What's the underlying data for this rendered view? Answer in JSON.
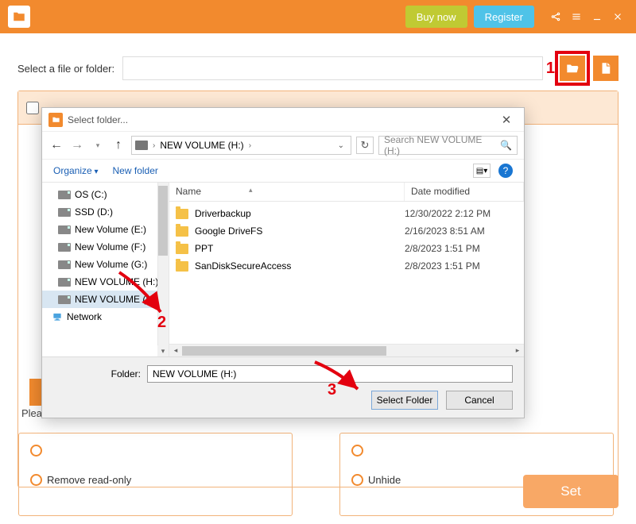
{
  "titlebar": {
    "buy": "Buy now",
    "register": "Register"
  },
  "select_label": "Select a file or folder:",
  "marker1": "1",
  "please": "Pleas",
  "options_left": {
    "row1": "",
    "row2": "Remove read-only"
  },
  "options_right": {
    "row1": "",
    "row2": "Unhide"
  },
  "set_button": "Set",
  "dialog": {
    "title": "Select folder...",
    "breadcrumb": "NEW VOLUME (H:)",
    "search_placeholder": "Search NEW VOLUME (H:)",
    "organize": "Organize",
    "newfolder": "New folder",
    "tree": [
      "OS (C:)",
      "SSD (D:)",
      "New Volume (E:)",
      "New Volume (F:)",
      "New Volume (G:)",
      "NEW VOLUME (H:)",
      "NEW VOLUME (H:)",
      "Network"
    ],
    "columns": {
      "name": "Name",
      "date": "Date modified"
    },
    "rows": [
      {
        "name": "Driverbackup",
        "date": "12/30/2022 2:12 PM"
      },
      {
        "name": "Google DriveFS",
        "date": "2/16/2023 8:51 AM"
      },
      {
        "name": "PPT",
        "date": "2/8/2023 1:51 PM"
      },
      {
        "name": "SanDiskSecureAccess",
        "date": "2/8/2023 1:51 PM"
      }
    ],
    "folder_label": "Folder:",
    "folder_value": "NEW VOLUME (H:)",
    "select_btn": "Select Folder",
    "cancel_btn": "Cancel"
  },
  "marker2": "2",
  "marker3": "3"
}
